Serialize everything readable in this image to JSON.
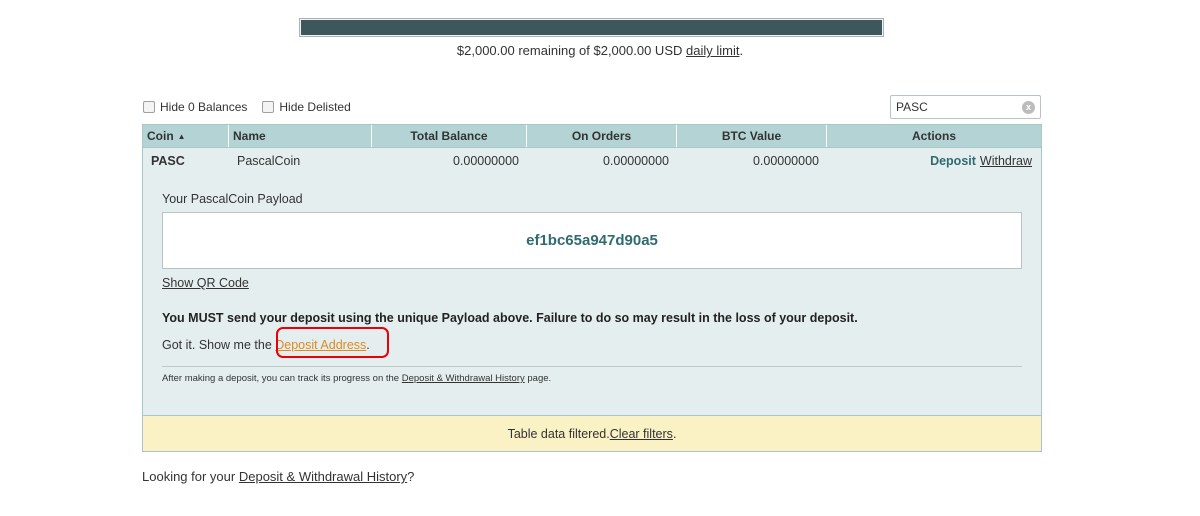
{
  "limit": {
    "remaining_fraction": 1.0,
    "text_prefix": "$2,000.00 remaining of $2,000.00 USD ",
    "link": "daily limit",
    "suffix": "."
  },
  "filters": {
    "hide_zero": "Hide 0 Balances",
    "hide_delisted": "Hide Delisted"
  },
  "search": {
    "value": "PASC",
    "clear_label": "x"
  },
  "table": {
    "columns": [
      "Coin",
      "Name",
      "Total Balance",
      "On Orders",
      "BTC Value",
      "Actions"
    ],
    "rows": [
      {
        "coin": "PASC",
        "name": "PascalCoin",
        "total": "0.00000000",
        "orders": "0.00000000",
        "btc": "0.00000000",
        "deposit": "Deposit",
        "withdraw": "Withdraw"
      }
    ]
  },
  "deposit_panel": {
    "payload_label": "Your PascalCoin Payload",
    "payload": "ef1bc65a947d90a5",
    "qr_link": "Show QR Code",
    "warning": "You MUST send your deposit using the unique Payload above. Failure to do so may result in the loss of your deposit.",
    "gotit_prefix": "Got it. Show me the ",
    "address_link": "Deposit Address",
    "gotit_suffix": ".",
    "track_prefix": "After making a deposit, you can track its progress on the ",
    "track_link": "Deposit & Withdrawal History",
    "track_suffix": " page."
  },
  "filter_notice": {
    "text": "Table data filtered. ",
    "link": "Clear filters",
    "suffix": "."
  },
  "history": {
    "prefix": "Looking for your ",
    "link": "Deposit & Withdrawal History",
    "suffix": "?"
  },
  "colors": {
    "accent": "#2f6b70",
    "header_bg": "#b4d3d4",
    "row_bg": "#e5eeee",
    "link_orange": "#e08a1e",
    "highlight_red": "#e8000a"
  }
}
